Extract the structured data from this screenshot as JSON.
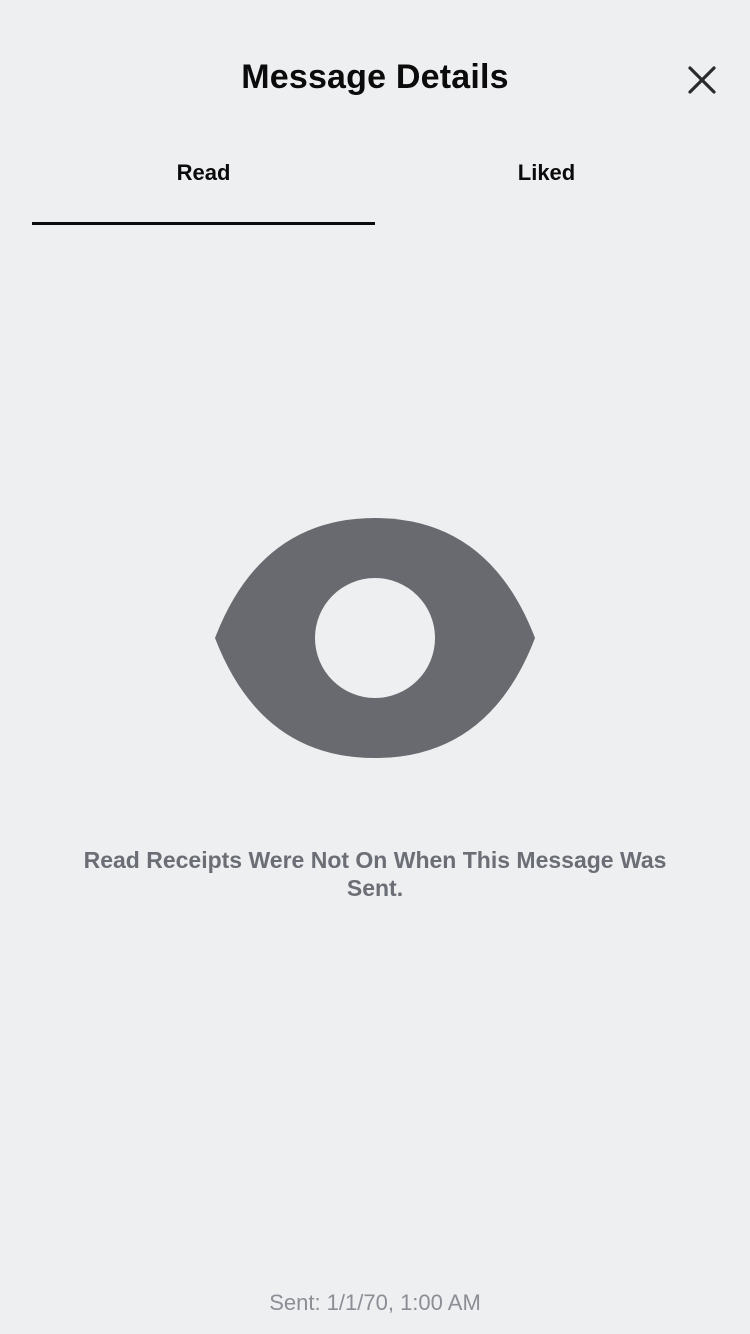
{
  "header": {
    "title": "Message Details",
    "close_icon": "close-icon"
  },
  "tabs": [
    {
      "label": "Read",
      "selected": true
    },
    {
      "label": "Liked",
      "selected": false
    }
  ],
  "empty_state": {
    "icon": "eye-icon",
    "message": "Read Receipts Were Not On When This Message Was Sent."
  },
  "footer": {
    "sent_text": "Sent: 1/1/70, 1:00 AM"
  },
  "colors": {
    "background": "#eeeff1",
    "icon_gray": "#686a70",
    "text_primary": "#0b0b0c",
    "text_secondary": "#6b6e75",
    "text_muted": "#8b8e94"
  }
}
